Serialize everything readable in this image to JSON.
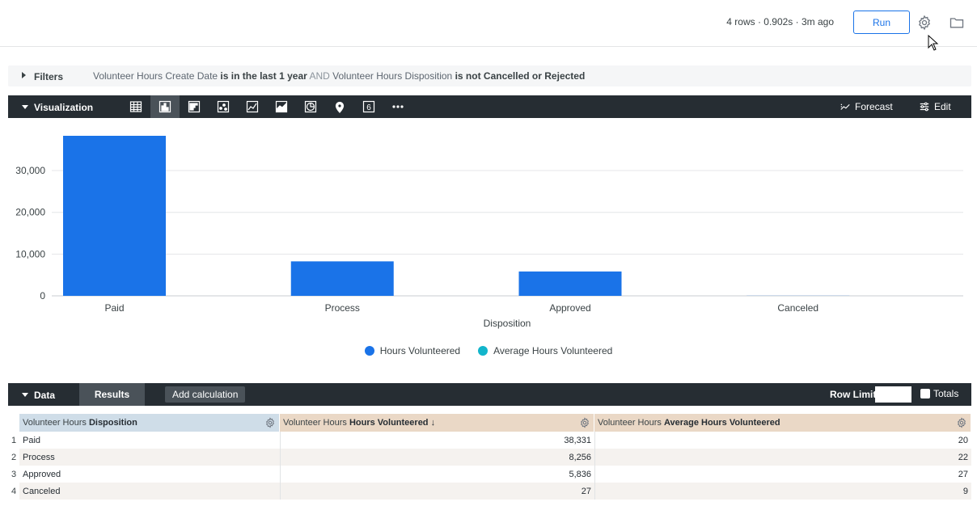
{
  "topbar": {
    "run_info": "4 rows · 0.902s · 3m ago",
    "run_label": "Run",
    "icons": [
      "gear-icon",
      "folder-icon"
    ]
  },
  "filters": {
    "label": "Filters",
    "expr": [
      {
        "t": "Volunteer Hours Create Date ",
        "s": "n"
      },
      {
        "t": "is in the last 1 year",
        "s": "b"
      },
      {
        "t": " AND ",
        "s": "a"
      },
      {
        "t": " Volunteer Hours Disposition ",
        "s": "n"
      },
      {
        "t": "is not Cancelled or Rejected",
        "s": "b"
      }
    ]
  },
  "visualization": {
    "label": "Visualization",
    "icons": [
      "table-icon",
      "column-chart-icon",
      "bar-chart-icon",
      "scatter-icon",
      "line-chart-icon",
      "area-chart-icon",
      "pie-chart-icon",
      "map-pin-icon",
      "single-value-icon",
      "more-icon"
    ],
    "forecast_label": "Forecast",
    "edit_label": "Edit"
  },
  "chart_data": {
    "type": "bar",
    "categories": [
      "Paid",
      "Process",
      "Approved",
      "Canceled"
    ],
    "series": [
      {
        "name": "Hours Volunteered",
        "values": [
          38331,
          8256,
          5836,
          27
        ],
        "color": "#1a73e8"
      },
      {
        "name": "Average Hours Volunteered",
        "values": [
          20,
          22,
          27,
          9
        ],
        "color": "#12b5cb"
      }
    ],
    "xlabel": "Disposition",
    "ylabel": "",
    "yticks": [
      0,
      10000,
      20000,
      30000
    ],
    "ytick_labels": [
      "0",
      "10,000",
      "20,000",
      "30,000"
    ],
    "ylim": [
      0,
      38331
    ],
    "grid": true,
    "legend": "bottom"
  },
  "data": {
    "label": "Data",
    "results_tab": "Results",
    "add_calc": "Add calculation",
    "row_limit": "Row Limit",
    "totals": "Totals"
  },
  "table": {
    "columns": [
      {
        "prefix": "Volunteer Hours ",
        "bold": "Disposition",
        "suffix": ""
      },
      {
        "prefix": "Volunteer Hours ",
        "bold": "Hours Volunteered",
        "suffix": " ↓"
      },
      {
        "prefix": "Volunteer Hours ",
        "bold": "Average Hours Volunteered",
        "suffix": ""
      }
    ],
    "rows": [
      {
        "n": "1",
        "disposition": "Paid",
        "hours": "38,331",
        "avg": "20"
      },
      {
        "n": "2",
        "disposition": "Process",
        "hours": "8,256",
        "avg": "22"
      },
      {
        "n": "3",
        "disposition": "Approved",
        "hours": "5,836",
        "avg": "27"
      },
      {
        "n": "4",
        "disposition": "Canceled",
        "hours": "27",
        "avg": "9"
      }
    ]
  }
}
